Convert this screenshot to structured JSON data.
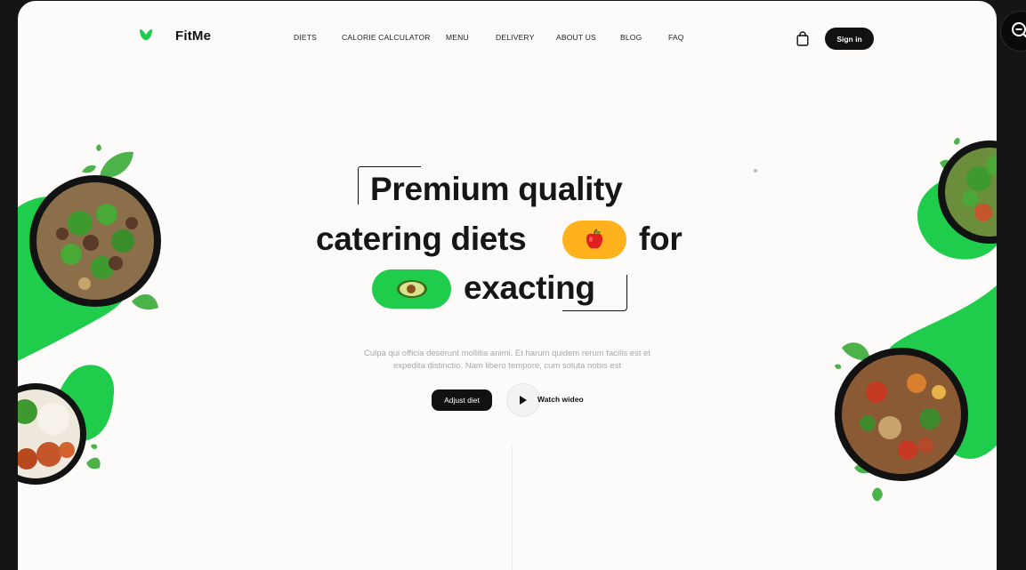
{
  "brand": {
    "name": "FitMe",
    "accent": "#1fcc4b"
  },
  "nav": {
    "items": [
      {
        "label": "DIETS"
      },
      {
        "label": "CALORIE CALCULATOR"
      },
      {
        "label": "MENU"
      },
      {
        "label": "DELIVERY"
      },
      {
        "label": "ABOUT US"
      },
      {
        "label": "BLOG"
      },
      {
        "label": "FAQ"
      }
    ]
  },
  "header": {
    "cart_icon": "shopping-bag-icon",
    "signin_label": "Sign in"
  },
  "hero": {
    "line1": "Premium quality",
    "line2a": "catering diets",
    "line2b": "for",
    "line3": "exacting",
    "pill_apple_icon": "apple-icon",
    "pill_apple_color": "#ffb21e",
    "pill_avocado_icon": "avocado-icon",
    "pill_avocado_color": "#1fcc4b",
    "description": "Culpa qui officia deserunt mollitia animi. Et harum quidem rerum facilis est et expedita distinctio. Nam libero tempore, cum soluta nobis est",
    "primary_button": "Adjust diet",
    "video_button": "Watch wideo"
  },
  "window_controls": {
    "zoom_icon": "zoom-out-icon"
  }
}
